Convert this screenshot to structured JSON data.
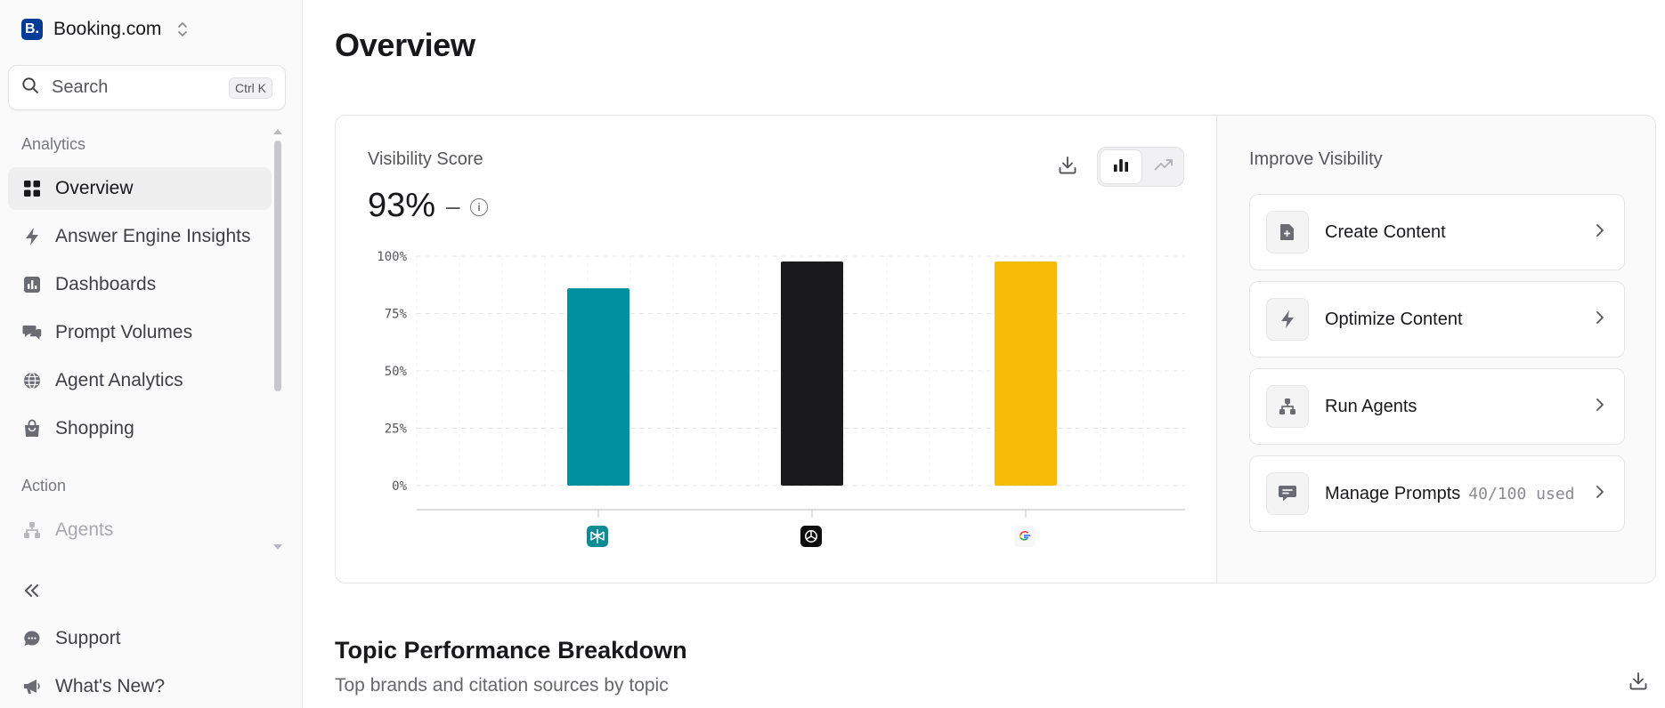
{
  "sidebar": {
    "brand": "Booking.com",
    "brand_logo": "B.",
    "search_label": "Search",
    "search_shortcut": "Ctrl K",
    "sections": [
      {
        "label": "Analytics",
        "items": [
          {
            "label": "Overview",
            "icon": "grid-icon",
            "active": true
          },
          {
            "label": "Answer Engine Insights",
            "icon": "bolt-icon"
          },
          {
            "label": "Dashboards",
            "icon": "bar-chart-icon"
          },
          {
            "label": "Prompt Volumes",
            "icon": "messages-icon"
          },
          {
            "label": "Agent Analytics",
            "icon": "globe-icon"
          },
          {
            "label": "Shopping",
            "icon": "shopping-bag-icon"
          }
        ]
      },
      {
        "label": "Action",
        "items": [
          {
            "label": "Agents",
            "icon": "hierarchy-icon"
          }
        ]
      }
    ],
    "bottom_items": [
      {
        "label": "Support",
        "icon": "chat-bubble-icon"
      },
      {
        "label": "What's New?",
        "icon": "megaphone-icon"
      }
    ]
  },
  "main": {
    "title": "Overview",
    "visibility": {
      "title": "Visibility Score",
      "value": "93%",
      "delta": "–"
    },
    "improve": {
      "title": "Improve Visibility",
      "actions": [
        {
          "label": "Create Content",
          "extra": "",
          "icon": "file-plus-icon"
        },
        {
          "label": "Optimize Content",
          "extra": "",
          "icon": "bolt-icon"
        },
        {
          "label": "Run Agents",
          "extra": "",
          "icon": "hierarchy-icon"
        },
        {
          "label": "Manage Prompts",
          "extra": "40/100 used",
          "icon": "message-square-icon"
        }
      ]
    },
    "topic": {
      "title": "Topic Performance Breakdown",
      "subtitle": "Top brands and citation sources by topic"
    }
  },
  "chart_data": {
    "type": "bar",
    "categories": [
      "Perplexity",
      "ChatGPT",
      "Google AI"
    ],
    "values": [
      86,
      100,
      100
    ],
    "colors": [
      "#00909e",
      "#1a1a1c",
      "#f8bb07"
    ],
    "ylim": [
      0,
      100
    ],
    "yticks": [
      "100%",
      "75%",
      "50%",
      "25%",
      "0%"
    ],
    "ytick_values": [
      100,
      75,
      50,
      25,
      0
    ],
    "grid": true
  },
  "colors": {
    "accent": "#18181b",
    "brand_blue": "#003b95"
  }
}
